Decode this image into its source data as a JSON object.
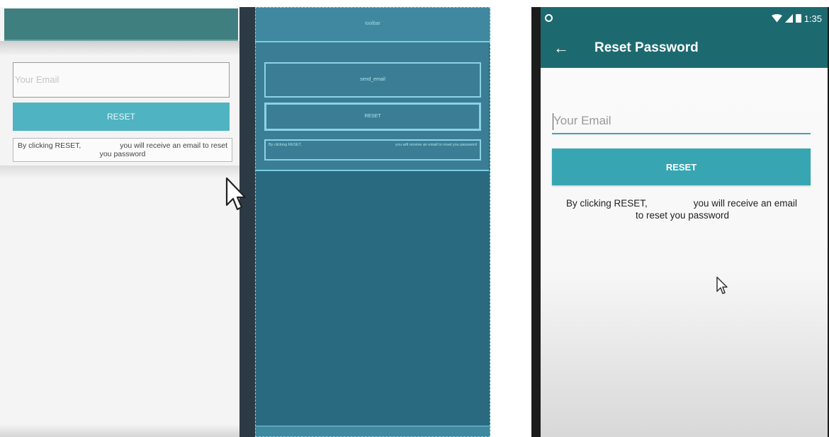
{
  "design_preview": {
    "email_placeholder": "Your Email",
    "reset_label": "RESET",
    "note_part1": "By clicking RESET,",
    "note_part2": "you will receive an email to reset",
    "note_part3": "you password"
  },
  "blueprint": {
    "toolbar_label": "toolbar",
    "email_label": "send_email",
    "reset_label": "RESET",
    "note_part1": "By clicking RESET,",
    "note_part2": "you will receive an email to reset you password"
  },
  "phone": {
    "status_bar": {
      "time": "1:35",
      "icons": [
        "signal-dot-icon",
        "wifi-icon",
        "cell-signal-icon",
        "battery-icon"
      ]
    },
    "app_bar": {
      "back_icon": "arrow-left-icon",
      "title": "Reset Password"
    },
    "form": {
      "email_placeholder": "Your Email",
      "email_value": "",
      "reset_label": "RESET",
      "note_part1": "By clicking RESET,",
      "note_part2": "you will receive an email",
      "note_part3": "to reset you password"
    }
  },
  "colors": {
    "toolbar_teal": "#1c6a70",
    "button_teal": "#38a6b2",
    "underline_teal": "#3aa5b3",
    "blueprint_bg": "#2a6a80"
  }
}
